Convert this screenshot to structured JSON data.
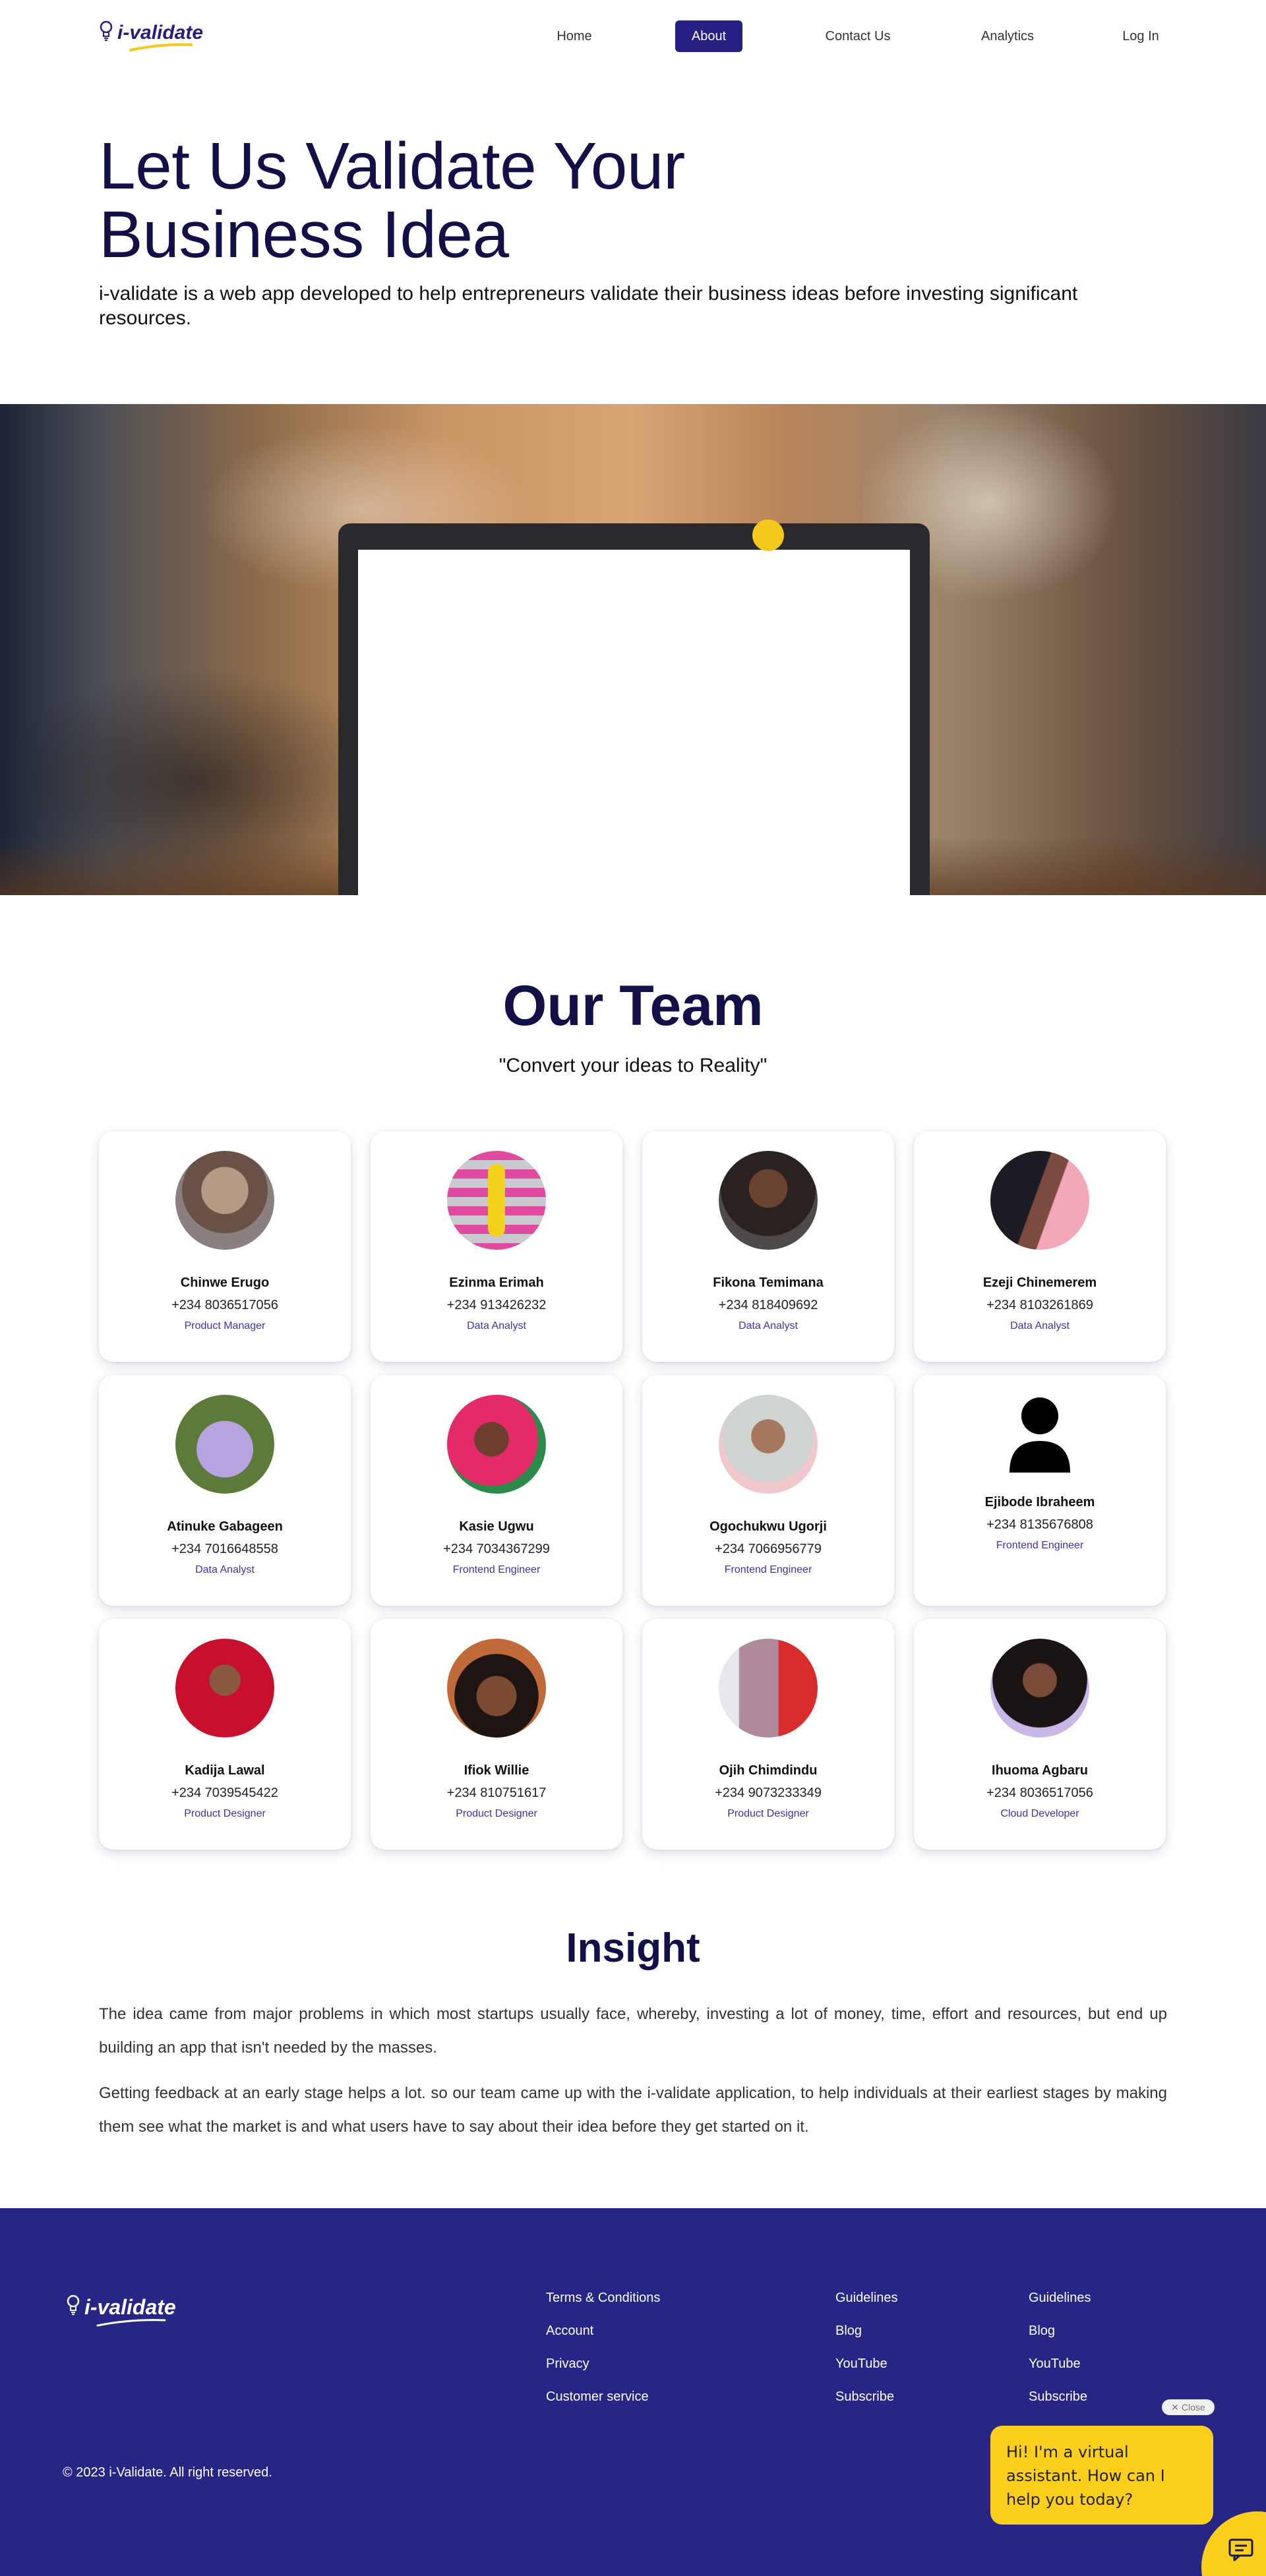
{
  "nav": {
    "logo_text": "i-validate",
    "links": [
      "Home",
      "About Us",
      "Contact Us",
      "Analytics",
      "Log In"
    ],
    "active": "About Us"
  },
  "hero": {
    "title": "Let Us Validate Your Business Idea",
    "subtitle": "i-validate is a web app developed to help entrepreneurs validate their business ideas before investing significant resources."
  },
  "team": {
    "title": "Our Team",
    "quote": "\"Convert your ideas to Reality\"",
    "members": [
      {
        "name": "Chinwe Erugo",
        "phone": "+234 8036517056",
        "role": "Product Manager",
        "avatar": "photo"
      },
      {
        "name": "Ezinma Erimah",
        "phone": "+234 913426232",
        "role": "Data Analyst",
        "avatar": "photo"
      },
      {
        "name": "Fikona Temimana",
        "phone": "+234 818409692",
        "role": "Data Analyst",
        "avatar": "photo"
      },
      {
        "name": "Ezeji Chinemerem",
        "phone": "+234 8103261869",
        "role": "Data Analyst",
        "avatar": "photo"
      },
      {
        "name": "Atinuke Gabageen",
        "phone": "+234 7016648558",
        "role": "Data Analyst",
        "avatar": "photo"
      },
      {
        "name": "Kasie Ugwu",
        "phone": "+234 7034367299",
        "role": "Frontend Engineer",
        "avatar": "photo"
      },
      {
        "name": "Ogochukwu Ugorji",
        "phone": "+234 7066956779",
        "role": "Frontend Engineer",
        "avatar": "photo"
      },
      {
        "name": "Ejibode Ibraheem",
        "phone": "+234 8135676808",
        "role": "Frontend Engineer",
        "avatar": "user-icon"
      },
      {
        "name": "Kadija Lawal",
        "phone": "+234 7039545422",
        "role": "Product Designer",
        "avatar": "photo"
      },
      {
        "name": "Ifiok Willie",
        "phone": "+234 810751617",
        "role": "Product Designer",
        "avatar": "photo"
      },
      {
        "name": "Ojih Chimdindu",
        "phone": "+234 9073233349",
        "role": "Product Designer",
        "avatar": "photo"
      },
      {
        "name": "Ihuoma Agbaru",
        "phone": "+234 8036517056",
        "role": "Cloud Developer",
        "avatar": "photo"
      }
    ]
  },
  "insight": {
    "title": "Insight",
    "p1": "The idea came from major problems in which most startups usually face, whereby, investing a lot of money, time, effort and resources, but end up building an app that isn't needed by the masses.",
    "p2": "Getting feedback at an early stage helps a lot. so our team came up with the i-validate application, to help individuals at their earliest stages by making them see what the market is and what users have to say about their idea before they get started on it."
  },
  "footer": {
    "logo_text": "i-validate",
    "col1": [
      "Terms & Conditions",
      "Account",
      "Privacy",
      "Customer service"
    ],
    "col2": [
      "Guidelines",
      "Blog",
      "YouTube",
      "Subscribe"
    ],
    "col3": [
      "Guidelines",
      "Blog",
      "YouTube",
      "Subscribe"
    ],
    "copyright": "© 2023 i-Validate. All right reserved."
  },
  "chat": {
    "close_label": "✕ Close",
    "message": "Hi! I'm a virtual assistant. How can I help you today?"
  },
  "colors": {
    "brand": "#261f84",
    "footer_bg": "#272687",
    "accent": "#fccf1c",
    "heading": "#121047"
  }
}
